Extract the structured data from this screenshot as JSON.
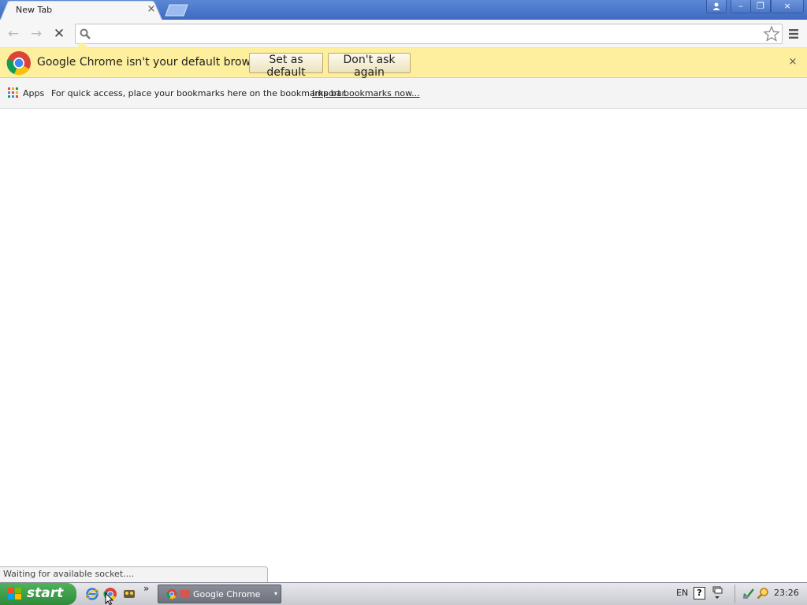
{
  "tab": {
    "title": "New Tab",
    "close_glyph": "×"
  },
  "window": {
    "user_icon": "user-icon",
    "minimize": "–",
    "restore": "❐",
    "close": "×"
  },
  "toolbar": {
    "back_glyph": "←",
    "forward_glyph": "→",
    "stop_glyph": "✕",
    "search_placeholder": "",
    "search_value": ""
  },
  "infobar": {
    "message": "Google Chrome isn't your default browser.",
    "set_default_label": "Set as default",
    "dont_ask_label": "Don't ask again",
    "close_glyph": "×"
  },
  "bookmarks": {
    "apps_label": "Apps",
    "hint": "For quick access, place your bookmarks here on the bookmarks bar.",
    "import_link": "Import bookmarks now..."
  },
  "status": {
    "text": "Waiting for available socket...."
  },
  "taskbar": {
    "start_label": "start",
    "more_glyph": "»",
    "chrome_task_label": "Google Chrome",
    "task_arrow": "▾",
    "language": "EN",
    "help_glyph": "?",
    "clock": "23:26"
  },
  "colors": {
    "titlebar": "#4a76c9",
    "infobar": "#fdef9d",
    "start": "#3c9c47"
  }
}
